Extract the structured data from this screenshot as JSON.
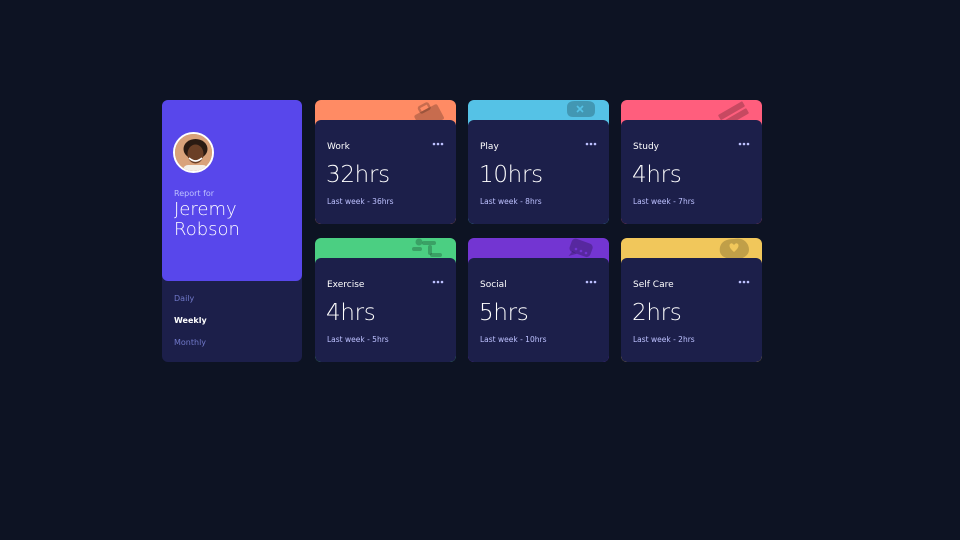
{
  "profile": {
    "report_label": "Report for",
    "name": "Jeremy Robson",
    "accent_color": "#5847eb",
    "periods": [
      {
        "label": "Daily",
        "active": false
      },
      {
        "label": "Weekly",
        "active": true
      },
      {
        "label": "Monthly",
        "active": false
      }
    ]
  },
  "cards": [
    {
      "title": "Work",
      "current": "32hrs",
      "previous": "Last week - 36hrs",
      "color": "#ff8b64",
      "icon": "briefcase-icon"
    },
    {
      "title": "Play",
      "current": "10hrs",
      "previous": "Last week - 8hrs",
      "color": "#55c2e6",
      "icon": "gamepad-icon"
    },
    {
      "title": "Study",
      "current": "4hrs",
      "previous": "Last week - 7hrs",
      "color": "#ff5e7d",
      "icon": "books-icon"
    },
    {
      "title": "Exercise",
      "current": "4hrs",
      "previous": "Last week - 5hrs",
      "color": "#4bcf82",
      "icon": "running-person-icon"
    },
    {
      "title": "Social",
      "current": "5hrs",
      "previous": "Last week - 10hrs",
      "color": "#7335d2",
      "icon": "chat-bubbles-icon"
    },
    {
      "title": "Self Care",
      "current": "2hrs",
      "previous": "Last week - 2hrs",
      "color": "#f1c75b",
      "icon": "heart-icon"
    }
  ]
}
